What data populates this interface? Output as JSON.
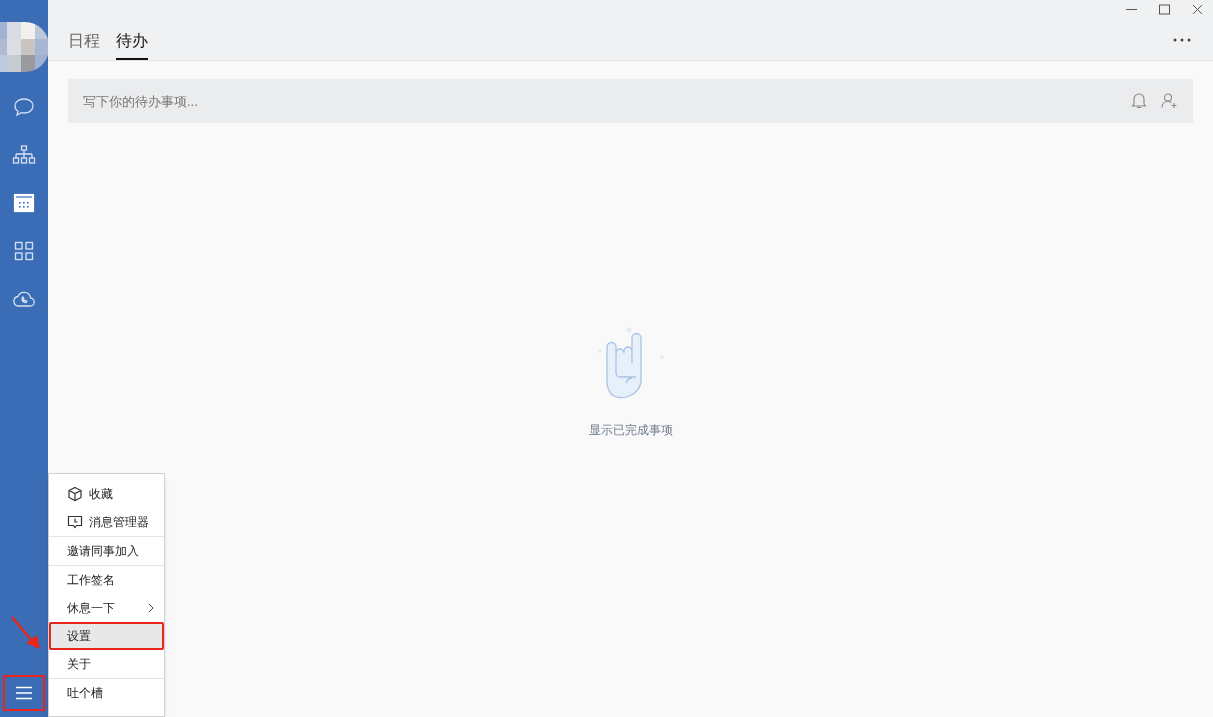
{
  "sidebar": {
    "items": [
      {
        "kind": "chat",
        "selected": false
      },
      {
        "kind": "org",
        "selected": false
      },
      {
        "kind": "calendar",
        "selected": true
      },
      {
        "kind": "apps",
        "selected": false
      },
      {
        "kind": "cloud",
        "selected": false
      }
    ],
    "menu_button": {
      "annotated": true
    }
  },
  "tabs": [
    {
      "label": "日程",
      "selected": false
    },
    {
      "label": "待办",
      "selected": true
    }
  ],
  "todo_input": {
    "placeholder": "写下你的待办事项..."
  },
  "empty_state": {
    "text": "显示已完成事项"
  },
  "menu": {
    "groups": [
      [
        {
          "label": "收藏",
          "kind": "cube",
          "submenu": false,
          "selected": false,
          "annotated": false
        },
        {
          "label": "消息管理器",
          "kind": "message",
          "submenu": false,
          "selected": false,
          "annotated": false
        }
      ],
      [
        {
          "label": "邀请同事加入",
          "submenu": false,
          "selected": false,
          "annotated": false
        }
      ],
      [
        {
          "label": "工作签名",
          "submenu": false,
          "selected": false,
          "annotated": false
        },
        {
          "label": "休息一下",
          "submenu": true,
          "selected": false,
          "annotated": false
        },
        {
          "label": "设置",
          "submenu": false,
          "selected": true,
          "annotated": true
        },
        {
          "label": "关于",
          "submenu": false,
          "selected": false,
          "annotated": false
        }
      ],
      [
        {
          "label": "吐个槽",
          "submenu": false,
          "selected": false,
          "annotated": false
        }
      ]
    ]
  }
}
